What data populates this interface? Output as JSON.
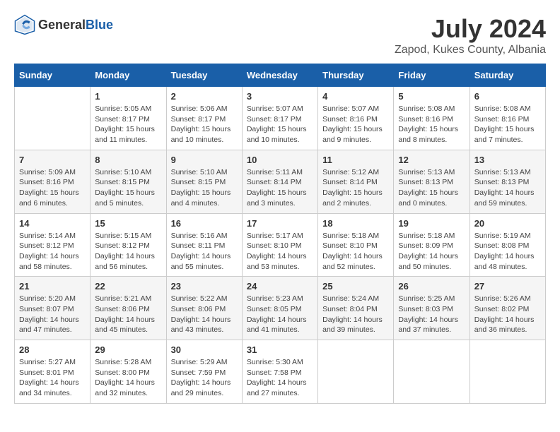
{
  "header": {
    "logo_general": "General",
    "logo_blue": "Blue",
    "month": "July 2024",
    "location": "Zapod, Kukes County, Albania"
  },
  "days_of_week": [
    "Sunday",
    "Monday",
    "Tuesday",
    "Wednesday",
    "Thursday",
    "Friday",
    "Saturday"
  ],
  "weeks": [
    [
      {
        "day": "",
        "sunrise": "",
        "sunset": "",
        "daylight": ""
      },
      {
        "day": "1",
        "sunrise": "Sunrise: 5:05 AM",
        "sunset": "Sunset: 8:17 PM",
        "daylight": "Daylight: 15 hours and 11 minutes."
      },
      {
        "day": "2",
        "sunrise": "Sunrise: 5:06 AM",
        "sunset": "Sunset: 8:17 PM",
        "daylight": "Daylight: 15 hours and 10 minutes."
      },
      {
        "day": "3",
        "sunrise": "Sunrise: 5:07 AM",
        "sunset": "Sunset: 8:17 PM",
        "daylight": "Daylight: 15 hours and 10 minutes."
      },
      {
        "day": "4",
        "sunrise": "Sunrise: 5:07 AM",
        "sunset": "Sunset: 8:16 PM",
        "daylight": "Daylight: 15 hours and 9 minutes."
      },
      {
        "day": "5",
        "sunrise": "Sunrise: 5:08 AM",
        "sunset": "Sunset: 8:16 PM",
        "daylight": "Daylight: 15 hours and 8 minutes."
      },
      {
        "day": "6",
        "sunrise": "Sunrise: 5:08 AM",
        "sunset": "Sunset: 8:16 PM",
        "daylight": "Daylight: 15 hours and 7 minutes."
      }
    ],
    [
      {
        "day": "7",
        "sunrise": "Sunrise: 5:09 AM",
        "sunset": "Sunset: 8:16 PM",
        "daylight": "Daylight: 15 hours and 6 minutes."
      },
      {
        "day": "8",
        "sunrise": "Sunrise: 5:10 AM",
        "sunset": "Sunset: 8:15 PM",
        "daylight": "Daylight: 15 hours and 5 minutes."
      },
      {
        "day": "9",
        "sunrise": "Sunrise: 5:10 AM",
        "sunset": "Sunset: 8:15 PM",
        "daylight": "Daylight: 15 hours and 4 minutes."
      },
      {
        "day": "10",
        "sunrise": "Sunrise: 5:11 AM",
        "sunset": "Sunset: 8:14 PM",
        "daylight": "Daylight: 15 hours and 3 minutes."
      },
      {
        "day": "11",
        "sunrise": "Sunrise: 5:12 AM",
        "sunset": "Sunset: 8:14 PM",
        "daylight": "Daylight: 15 hours and 2 minutes."
      },
      {
        "day": "12",
        "sunrise": "Sunrise: 5:13 AM",
        "sunset": "Sunset: 8:13 PM",
        "daylight": "Daylight: 15 hours and 0 minutes."
      },
      {
        "day": "13",
        "sunrise": "Sunrise: 5:13 AM",
        "sunset": "Sunset: 8:13 PM",
        "daylight": "Daylight: 14 hours and 59 minutes."
      }
    ],
    [
      {
        "day": "14",
        "sunrise": "Sunrise: 5:14 AM",
        "sunset": "Sunset: 8:12 PM",
        "daylight": "Daylight: 14 hours and 58 minutes."
      },
      {
        "day": "15",
        "sunrise": "Sunrise: 5:15 AM",
        "sunset": "Sunset: 8:12 PM",
        "daylight": "Daylight: 14 hours and 56 minutes."
      },
      {
        "day": "16",
        "sunrise": "Sunrise: 5:16 AM",
        "sunset": "Sunset: 8:11 PM",
        "daylight": "Daylight: 14 hours and 55 minutes."
      },
      {
        "day": "17",
        "sunrise": "Sunrise: 5:17 AM",
        "sunset": "Sunset: 8:10 PM",
        "daylight": "Daylight: 14 hours and 53 minutes."
      },
      {
        "day": "18",
        "sunrise": "Sunrise: 5:18 AM",
        "sunset": "Sunset: 8:10 PM",
        "daylight": "Daylight: 14 hours and 52 minutes."
      },
      {
        "day": "19",
        "sunrise": "Sunrise: 5:18 AM",
        "sunset": "Sunset: 8:09 PM",
        "daylight": "Daylight: 14 hours and 50 minutes."
      },
      {
        "day": "20",
        "sunrise": "Sunrise: 5:19 AM",
        "sunset": "Sunset: 8:08 PM",
        "daylight": "Daylight: 14 hours and 48 minutes."
      }
    ],
    [
      {
        "day": "21",
        "sunrise": "Sunrise: 5:20 AM",
        "sunset": "Sunset: 8:07 PM",
        "daylight": "Daylight: 14 hours and 47 minutes."
      },
      {
        "day": "22",
        "sunrise": "Sunrise: 5:21 AM",
        "sunset": "Sunset: 8:06 PM",
        "daylight": "Daylight: 14 hours and 45 minutes."
      },
      {
        "day": "23",
        "sunrise": "Sunrise: 5:22 AM",
        "sunset": "Sunset: 8:06 PM",
        "daylight": "Daylight: 14 hours and 43 minutes."
      },
      {
        "day": "24",
        "sunrise": "Sunrise: 5:23 AM",
        "sunset": "Sunset: 8:05 PM",
        "daylight": "Daylight: 14 hours and 41 minutes."
      },
      {
        "day": "25",
        "sunrise": "Sunrise: 5:24 AM",
        "sunset": "Sunset: 8:04 PM",
        "daylight": "Daylight: 14 hours and 39 minutes."
      },
      {
        "day": "26",
        "sunrise": "Sunrise: 5:25 AM",
        "sunset": "Sunset: 8:03 PM",
        "daylight": "Daylight: 14 hours and 37 minutes."
      },
      {
        "day": "27",
        "sunrise": "Sunrise: 5:26 AM",
        "sunset": "Sunset: 8:02 PM",
        "daylight": "Daylight: 14 hours and 36 minutes."
      }
    ],
    [
      {
        "day": "28",
        "sunrise": "Sunrise: 5:27 AM",
        "sunset": "Sunset: 8:01 PM",
        "daylight": "Daylight: 14 hours and 34 minutes."
      },
      {
        "day": "29",
        "sunrise": "Sunrise: 5:28 AM",
        "sunset": "Sunset: 8:00 PM",
        "daylight": "Daylight: 14 hours and 32 minutes."
      },
      {
        "day": "30",
        "sunrise": "Sunrise: 5:29 AM",
        "sunset": "Sunset: 7:59 PM",
        "daylight": "Daylight: 14 hours and 29 minutes."
      },
      {
        "day": "31",
        "sunrise": "Sunrise: 5:30 AM",
        "sunset": "Sunset: 7:58 PM",
        "daylight": "Daylight: 14 hours and 27 minutes."
      },
      {
        "day": "",
        "sunrise": "",
        "sunset": "",
        "daylight": ""
      },
      {
        "day": "",
        "sunrise": "",
        "sunset": "",
        "daylight": ""
      },
      {
        "day": "",
        "sunrise": "",
        "sunset": "",
        "daylight": ""
      }
    ]
  ]
}
